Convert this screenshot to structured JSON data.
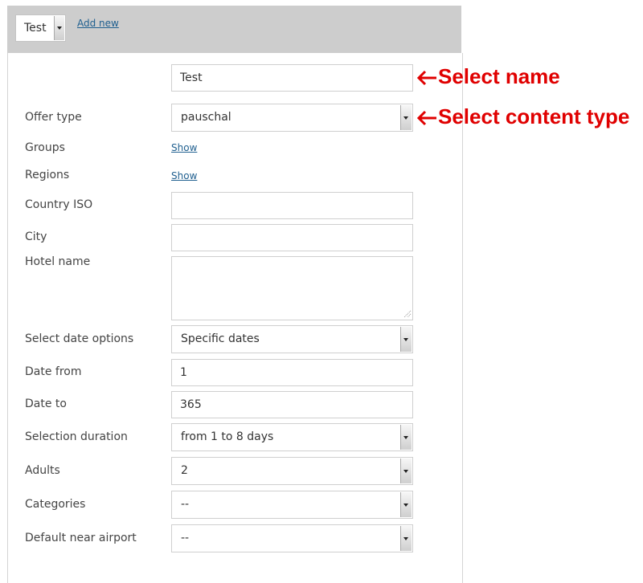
{
  "toolbar": {
    "select_value": "Test",
    "add_new_label": "Add new"
  },
  "name_field": {
    "value": "Test"
  },
  "annotations": {
    "select_name": "Select name",
    "select_content_type": "Select content type",
    "color": "#e00000"
  },
  "form": {
    "offer_type": {
      "label": "Offer type",
      "value": "pauschal"
    },
    "groups": {
      "label": "Groups",
      "link": "Show"
    },
    "regions": {
      "label": "Regions",
      "link": "Show"
    },
    "country_iso": {
      "label": "Country ISO",
      "value": ""
    },
    "city": {
      "label": "City",
      "value": ""
    },
    "hotel_name": {
      "label": "Hotel name",
      "value": ""
    },
    "date_options": {
      "label": "Select date options",
      "value": "Specific dates"
    },
    "date_from": {
      "label": "Date from",
      "value": "1"
    },
    "date_to": {
      "label": "Date to",
      "value": "365"
    },
    "selection_duration": {
      "label": "Selection duration",
      "value": "from 1 to 8 days"
    },
    "adults": {
      "label": "Adults",
      "value": "2"
    },
    "categories": {
      "label": "Categories",
      "value": "--"
    },
    "near_airport": {
      "label": "Default near airport",
      "value": "--"
    }
  },
  "colors": {
    "toolbar_bg": "#cdcdcd",
    "link": "#1f5f8f"
  }
}
